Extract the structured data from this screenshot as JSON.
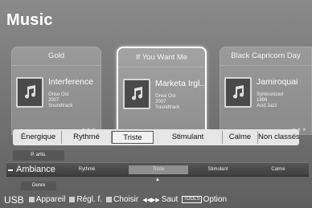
{
  "title": "Music",
  "cards": [
    {
      "header": "Gold",
      "track": "Interference",
      "artist": "",
      "album": "Once Ost",
      "year": "2007",
      "genre": "Soundtrack",
      "icon": "music-note-icon"
    },
    {
      "header": "If You Want Me",
      "track": "Marketa Irgl...",
      "album": "Once Ost",
      "year": "2007",
      "genre": "Soundtrack",
      "icon": "music-note-icon"
    },
    {
      "header": "Black Capricorn Day",
      "track": "Jamiroquai",
      "album": "Synkronized",
      "year": "1999",
      "genre": "Acid Jazz",
      "icon": "music-note-icon"
    }
  ],
  "moods": [
    "Énergique",
    "Rythmé",
    "Triste",
    "Stimulant",
    "Calme",
    "Non classés"
  ],
  "filter": {
    "top_label": "P. artis.",
    "current": "Ambiance",
    "bottom_label": "Genre",
    "strip": [
      "Rythmé",
      "Triste",
      "Stimulant",
      "Calme"
    ]
  },
  "help": {
    "source": "USB",
    "device": "Appareil",
    "settings": "Régl. f.",
    "choose": "Choisir",
    "skip": "Saut",
    "tools_badge": "TOOLS",
    "option": "Option"
  },
  "colors": {
    "selected_border": "#ffffff",
    "mood_bar": "#e6e6e6"
  }
}
